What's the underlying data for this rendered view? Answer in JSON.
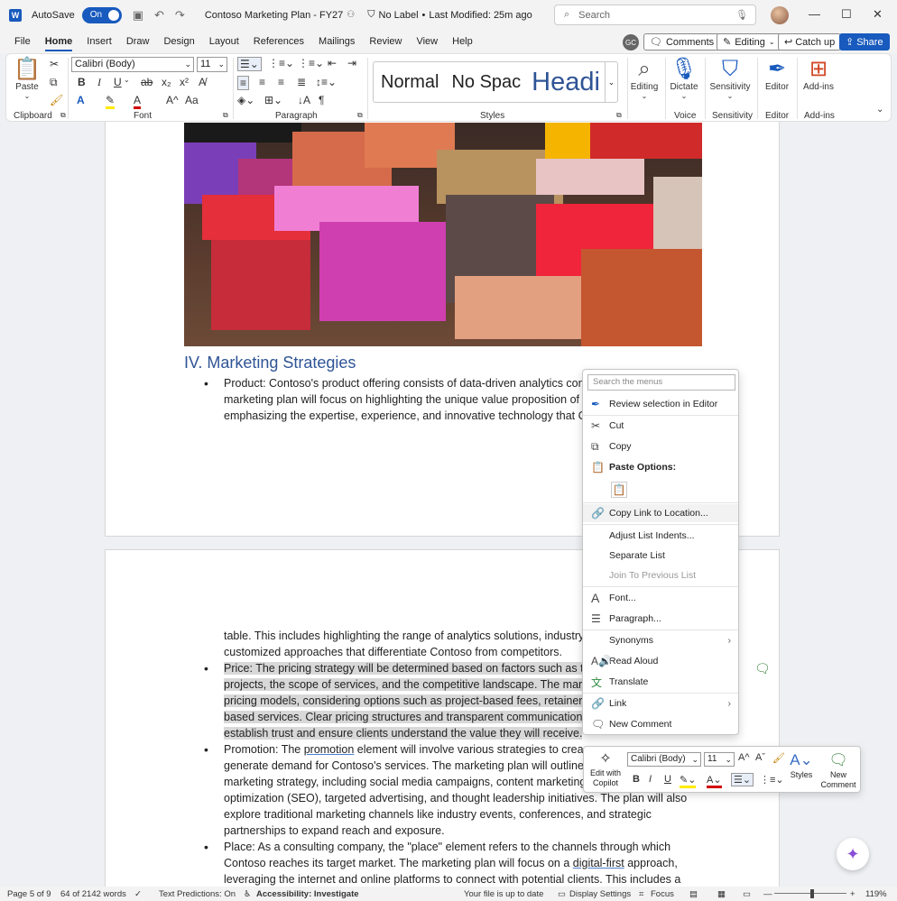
{
  "titlebar": {
    "autosave_label": "AutoSave",
    "autosave_state": "On",
    "doc_title": "Contoso Marketing Plan - FY27",
    "sensitivity_label": "No Label",
    "modified": "Last Modified: 25m ago",
    "search_placeholder": "Search"
  },
  "tabs": [
    "File",
    "Home",
    "Insert",
    "Draw",
    "Design",
    "Layout",
    "References",
    "Mailings",
    "Review",
    "View",
    "Help"
  ],
  "active_tab": "Home",
  "top_right": {
    "comments": "Comments",
    "editing": "Editing",
    "catch_up": "Catch up",
    "share": "Share",
    "avatar_initials": "GC"
  },
  "ribbon": {
    "paste": "Paste",
    "clipboard": "Clipboard",
    "font_name": "Calibri (Body)",
    "font_size": "11",
    "font": "Font",
    "paragraph": "Paragraph",
    "styles": "Styles",
    "style_normal": "Normal",
    "style_nospace": "No Spac",
    "style_heading": "Headi",
    "editing": "Editing",
    "dictate": "Dictate",
    "voice": "Voice",
    "sensitivity": "Sensitivity",
    "editor": "Editor",
    "addins": "Add-ins"
  },
  "document": {
    "heading": "IV. Marketing Strategies",
    "page1_bullet": [
      "Product: Contoso's product offering consists of data-driven analytics cons",
      "marketing plan will focus on highlighting the unique value proposition of",
      "emphasizing the expertise, experience, and innovative technology that Co"
    ],
    "page2_cont": [
      "table. This includes highlighting the range of analytics solutions, industry-",
      "customized approaches that differentiate Contoso from competitors."
    ],
    "price": [
      "Price: The pricing strategy will be determined based on factors such as th",
      "projects, the scope of services, and the competitive landscape. The marke",
      "pricing models, considering options such as project-based fees, retainer m",
      "based services. Clear pricing structures and transparent communication w",
      "establish trust and ensure clients understand the value they will receive."
    ],
    "promotion": {
      "line1_pre": "Promotion: The ",
      "line1_link": "promotion",
      "line1_post": " element will involve various strategies to crea",
      "rest": [
        "generate demand for Contoso's services. The marketing plan will outline",
        "marketing strategy, including social media campaigns, content marketing,",
        "optimization (SEO), targeted advertising, and thought leadership initiatives. The plan will also",
        "explore traditional marketing channels like industry events, conferences, and strategic",
        "partnerships to expand reach and exposure."
      ]
    },
    "place": {
      "line1": "Place: As a consulting company, the \"place\" element refers to the channels through which",
      "line2_pre": "Contoso reaches its target market. The marketing plan will focus on a ",
      "line2_link": "digital-first",
      "line2_post": " approach,",
      "line3": "leveraging the internet and online platforms to connect with potential clients. This includes a"
    }
  },
  "context_menu": {
    "search_placeholder": "Search the menus",
    "items": {
      "review_editor": "Review selection in Editor",
      "cut": "Cut",
      "copy": "Copy",
      "paste_options": "Paste Options:",
      "copy_link": "Copy Link to Location...",
      "adjust_indents": "Adjust List Indents...",
      "separate_list": "Separate List",
      "join_previous": "Join To Previous List",
      "font": "Font...",
      "paragraph": "Paragraph...",
      "synonyms": "Synonyms",
      "read_aloud": "Read Aloud",
      "translate": "Translate",
      "link": "Link",
      "new_comment": "New Comment"
    }
  },
  "mini_toolbar": {
    "edit_copilot": "Edit with Copilot",
    "font_name": "Calibri (Body)",
    "font_size": "11",
    "styles": "Styles",
    "new_comment": "New Comment"
  },
  "statusbar": {
    "page": "Page 5 of 9",
    "words": "64 of 2142 words",
    "text_predictions": "Text Predictions: On",
    "accessibility": "Accessibility: Investigate",
    "saved": "Your file is up to date",
    "display_settings": "Display Settings",
    "focus": "Focus",
    "zoom": "119%"
  },
  "colors": {
    "accent": "#185abd",
    "heading": "#2f5496",
    "selection": "#d8d8d8"
  }
}
